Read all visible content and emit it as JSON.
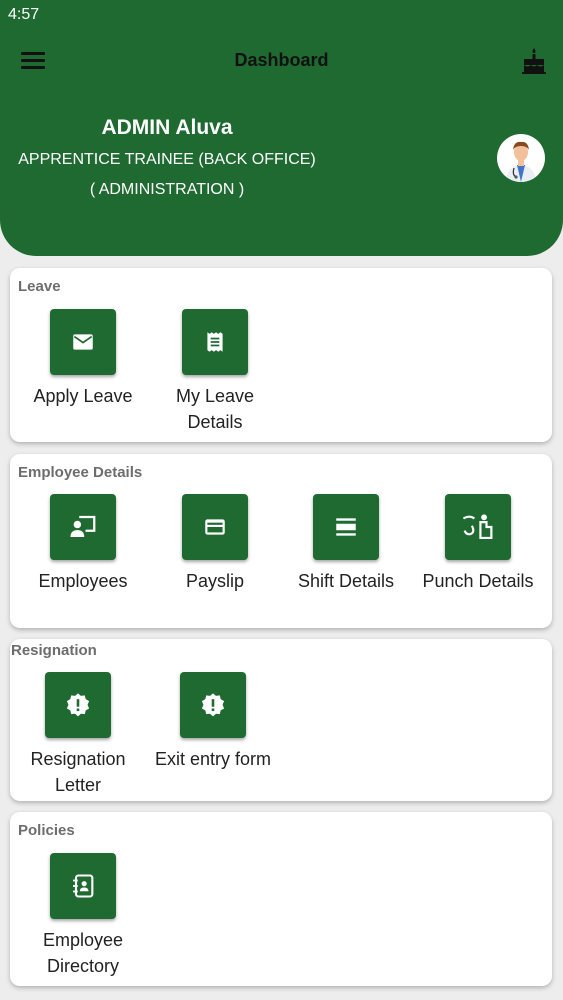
{
  "status_bar": {
    "time": "4:57"
  },
  "header": {
    "title": "Dashboard"
  },
  "user": {
    "name": "ADMIN Aluva",
    "role": "APPRENTICE TRAINEE (BACK OFFICE)",
    "department": "( ADMINISTRATION )"
  },
  "sections": {
    "leave": {
      "title": "Leave",
      "items": [
        {
          "label": "Apply Leave",
          "icon": "mail-icon"
        },
        {
          "label": "My Leave Details",
          "icon": "receipt-icon"
        }
      ]
    },
    "employee_details": {
      "title": "Employee Details",
      "items": [
        {
          "label": "Employees",
          "icon": "person-screen-icon"
        },
        {
          "label": "Payslip",
          "icon": "card-icon"
        },
        {
          "label": "Shift Details",
          "icon": "shift-icon"
        },
        {
          "label": "Punch Details",
          "icon": "punch-icon"
        }
      ]
    },
    "resignation": {
      "title": "Resignation",
      "items": [
        {
          "label": "Resignation Letter",
          "icon": "alert-badge-icon"
        },
        {
          "label": "Exit entry form",
          "icon": "alert-badge-icon"
        }
      ]
    },
    "policies": {
      "title": "Policies",
      "items": [
        {
          "label": "Employee Directory",
          "icon": "contact-book-icon"
        }
      ]
    }
  },
  "colors": {
    "primary": "#1f6a31",
    "background": "#ededed",
    "section_title": "#6d6d6d"
  }
}
